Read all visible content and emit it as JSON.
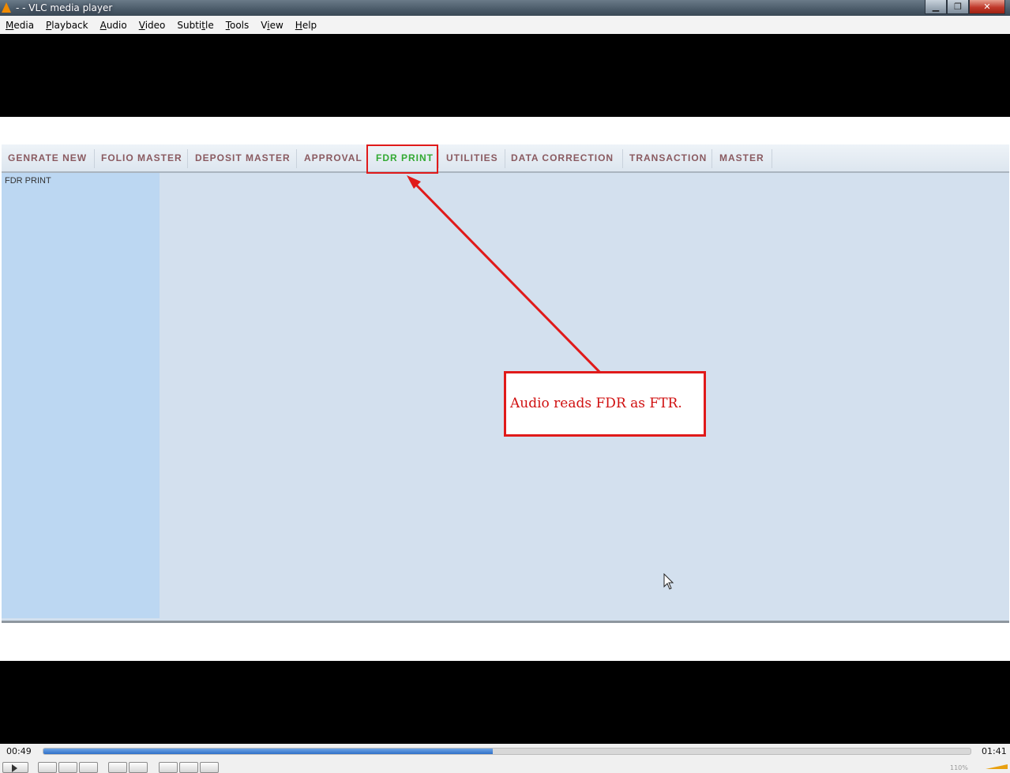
{
  "window": {
    "title": "- - VLC media player",
    "minimize_glyph": "▁",
    "maximize_glyph": "❐",
    "close_glyph": "✕"
  },
  "menu": [
    {
      "accel": "M",
      "rest": "edia"
    },
    {
      "accel": "P",
      "rest": "layback"
    },
    {
      "accel": "A",
      "rest": "udio"
    },
    {
      "accel": "V",
      "rest": "ideo"
    },
    {
      "pre": "Subti",
      "accel": "t",
      "rest": "le"
    },
    {
      "accel": "T",
      "rest": "ools"
    },
    {
      "pre": "V",
      "accel": "i",
      "rest": "ew"
    },
    {
      "accel": "H",
      "rest": "elp"
    }
  ],
  "video_content": {
    "tabs": [
      "GENRATE NEW",
      "FOLIO MASTER",
      "DEPOSIT MASTER",
      "APPROVAL",
      "FDR PRINT",
      "UTILITIES",
      "DATA CORRECTION",
      "TRANSACTION",
      "MASTER"
    ],
    "active_tab": "FDR PRINT",
    "sidebar_label": "FDR PRINT",
    "annotation_text": "Audio reads FDR as FTR.",
    "annotation_color": "#e01a1a"
  },
  "playback": {
    "elapsed": "00:49",
    "total": "01:41",
    "progress": 0.485,
    "volume_label": "110%"
  },
  "colors": {
    "active_tab": "#33aa33",
    "inactive_tab": "#8a5a60",
    "seek_fill": "#2f6fc8",
    "volume": "#e8a010"
  }
}
